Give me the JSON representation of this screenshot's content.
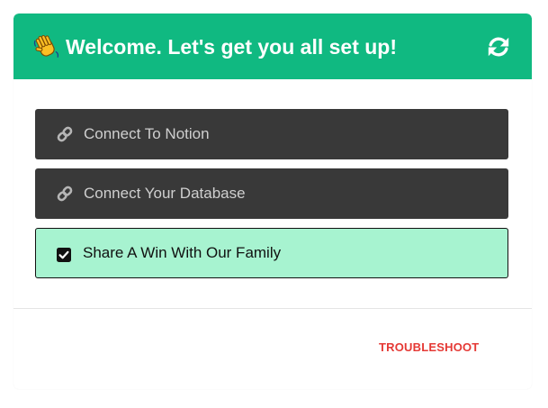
{
  "header": {
    "title": "Welcome. Let's get you all set up!",
    "emoji_icon": "waving-hand-icon",
    "refresh_icon": "refresh-icon",
    "background_color": "#10b981"
  },
  "steps": [
    {
      "label": "Connect To Notion",
      "icon": "link-icon",
      "status": "pending"
    },
    {
      "label": "Connect Your Database",
      "icon": "link-icon",
      "status": "pending"
    },
    {
      "label": "Share A Win With Our Family",
      "icon": "checkbox-checked-icon",
      "status": "done"
    }
  ],
  "footer": {
    "troubleshoot_label": "TROUBLESHOOT",
    "troubleshoot_color": "#e53935"
  }
}
